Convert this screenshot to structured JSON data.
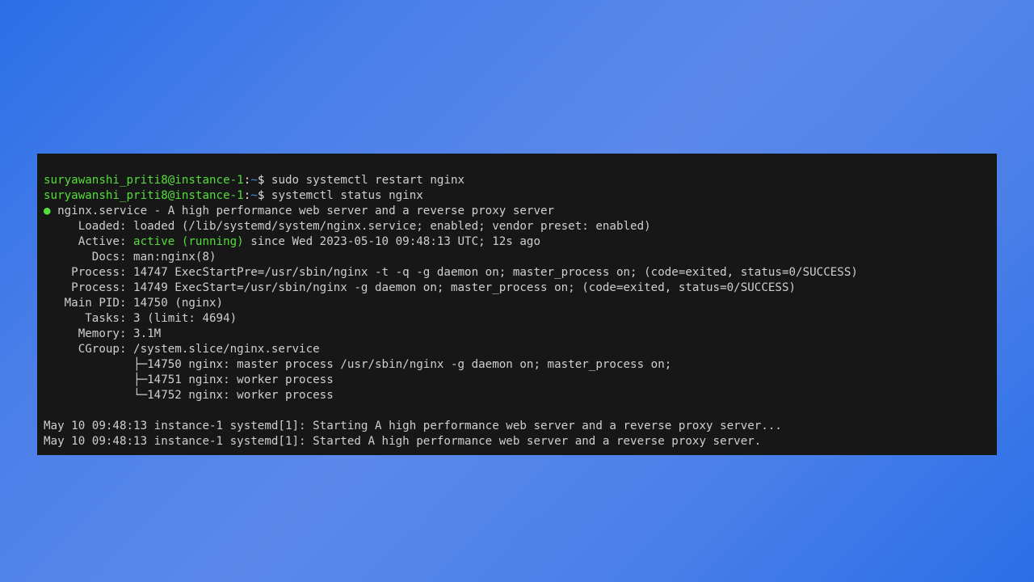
{
  "prompt": {
    "user_host": "suryawanshi_priti8@instance-1",
    "sep1": ":",
    "cwd": "~",
    "sep2": "$ "
  },
  "cmd1": "sudo systemctl restart nginx",
  "cmd2": "systemctl status nginx",
  "status": {
    "dot": "●",
    "header": " nginx.service - A high performance web server and a reverse proxy server",
    "loaded": "     Loaded: loaded (/lib/systemd/system/nginx.service; enabled; vendor preset: enabled)",
    "active_label": "     Active: ",
    "active_value": "active (running)",
    "active_rest": " since Wed 2023-05-10 09:48:13 UTC; 12s ago",
    "docs": "       Docs: man:nginx(8)",
    "proc1": "    Process: 14747 ExecStartPre=/usr/sbin/nginx -t -q -g daemon on; master_process on; (code=exited, status=0/SUCCESS)",
    "proc2": "    Process: 14749 ExecStart=/usr/sbin/nginx -g daemon on; master_process on; (code=exited, status=0/SUCCESS)",
    "mainpid": "   Main PID: 14750 (nginx)",
    "tasks": "      Tasks: 3 (limit: 4694)",
    "memory": "     Memory: 3.1M",
    "cgroup": "     CGroup: /system.slice/nginx.service",
    "tree1": "             ├─14750 nginx: master process /usr/sbin/nginx -g daemon on; master_process on;",
    "tree2": "             ├─14751 nginx: worker process",
    "tree3": "             └─14752 nginx: worker process"
  },
  "blank": " ",
  "log1": "May 10 09:48:13 instance-1 systemd[1]: Starting A high performance web server and a reverse proxy server...",
  "log2": "May 10 09:48:13 instance-1 systemd[1]: Started A high performance web server and a reverse proxy server."
}
